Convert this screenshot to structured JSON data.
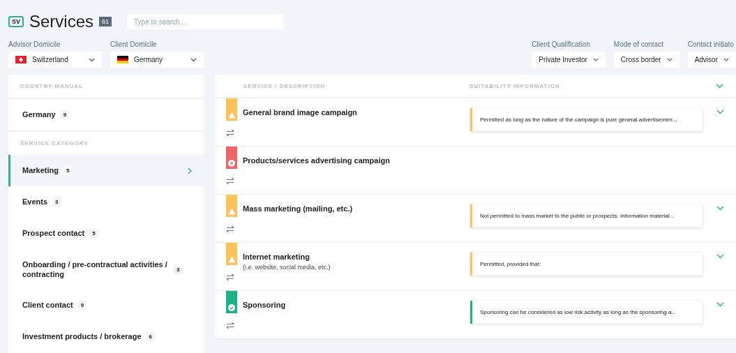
{
  "header": {
    "logo": "SV",
    "title": "Services",
    "count": "61",
    "search": {
      "placeholder": "Type to search..."
    }
  },
  "filters_left": [
    {
      "label": "Advisor Domicile",
      "value": "Switzerland",
      "kind": "ch"
    },
    {
      "label": "Client Domicile",
      "value": "Germany",
      "kind": "de"
    }
  ],
  "filters_right": [
    {
      "label": "Client Qualification",
      "value": "Private Investor"
    },
    {
      "label": "Mode of contact",
      "value": "Cross border"
    },
    {
      "label": "Contact initiato",
      "value": "Advisor"
    }
  ],
  "sidebar": {
    "sections": [
      {
        "heading": "COUNTRY-MANUAL",
        "items": [
          {
            "label": "Germany",
            "count": "9",
            "selected": false
          }
        ]
      },
      {
        "heading": "SERVICE CATEGORY",
        "items": [
          {
            "label": "Marketing",
            "count": "5",
            "selected": true
          },
          {
            "label": "Events",
            "count": "3",
            "selected": false
          },
          {
            "label": "Prospect contact",
            "count": "5",
            "selected": false
          },
          {
            "label": "Onboarding / pre-contractual activities / contracting",
            "count": "3",
            "selected": false
          },
          {
            "label": "Client contact",
            "count": "9",
            "selected": false
          },
          {
            "label": "Investment products / brokerage",
            "count": "6",
            "selected": false
          }
        ]
      }
    ]
  },
  "table": {
    "columns": [
      "SERVICE / DESCRIPTION",
      "SUITABILITY INFORMATION"
    ],
    "rows": [
      {
        "kind": "warning",
        "title": "General brand image campaign",
        "note": "Permitted as long as the nature of the campaign is pure general advertisemen..."
      },
      {
        "kind": "prohibited",
        "title": "Products/services advertising campaign"
      },
      {
        "kind": "warning",
        "title": "Mass marketing (mailing, etc.)",
        "note": "Not permitted to mass market to the public or prospects. Information material..."
      },
      {
        "kind": "warning",
        "title": "Internet marketing",
        "description": "(i.e. website, social media, etc.)",
        "note": "Permitted, provided that:"
      },
      {
        "kind": "permitted",
        "title": "Sponsoring",
        "note": "Sponsoring can be considered as low risk activity as long as the sponsoring a..."
      }
    ]
  }
}
